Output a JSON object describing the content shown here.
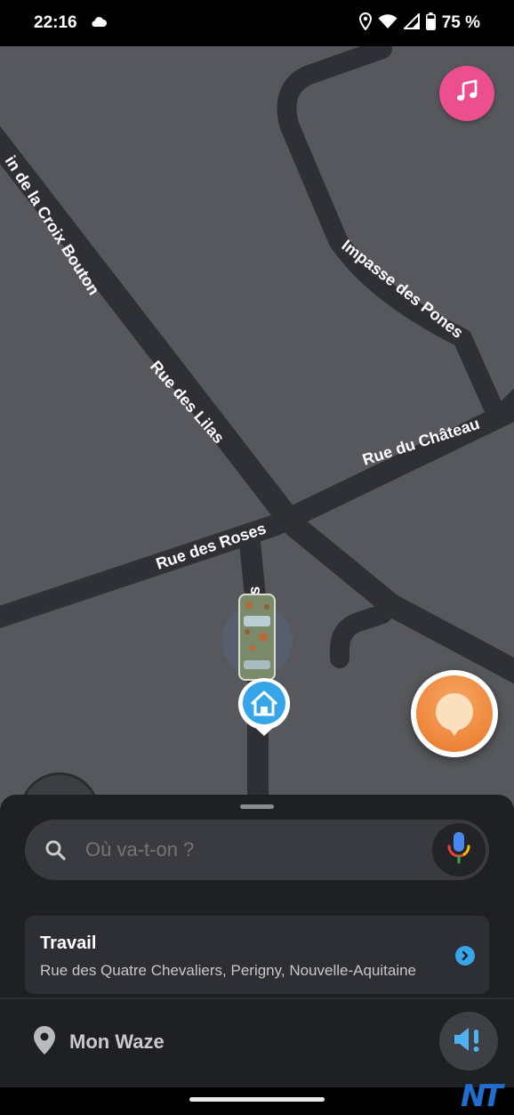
{
  "status_bar": {
    "time": "22:16",
    "battery": "75 %",
    "icons": [
      "cloud-icon",
      "location-icon",
      "wifi-icon",
      "signal-icon",
      "battery-icon"
    ]
  },
  "map": {
    "streets": [
      "in de la Croix Bouton",
      "Rue des Lilas",
      "Impasse des Pones",
      "Rue du Château",
      "Rue des Roses",
      "nes"
    ],
    "markers": [
      "car-icon",
      "home-icon"
    ]
  },
  "buttons": {
    "music": "music-icon",
    "report": "report-icon",
    "sound": "sound-icon"
  },
  "sheet": {
    "search_placeholder": "Où va-t-on ?",
    "destination": {
      "title": "Travail",
      "address": "Rue des Quatre Chevaliers, Perigny, Nouvelle-Aquitaine"
    },
    "my_waze": "Mon Waze"
  },
  "watermark": "NT",
  "colors": {
    "map_bg": "#56585d",
    "road": "#2f3035",
    "music_button": "#ec4f8d",
    "report_button": "#ef8a3f",
    "sheet_bg": "#1f2024",
    "accent_blue": "#37a6e8"
  }
}
